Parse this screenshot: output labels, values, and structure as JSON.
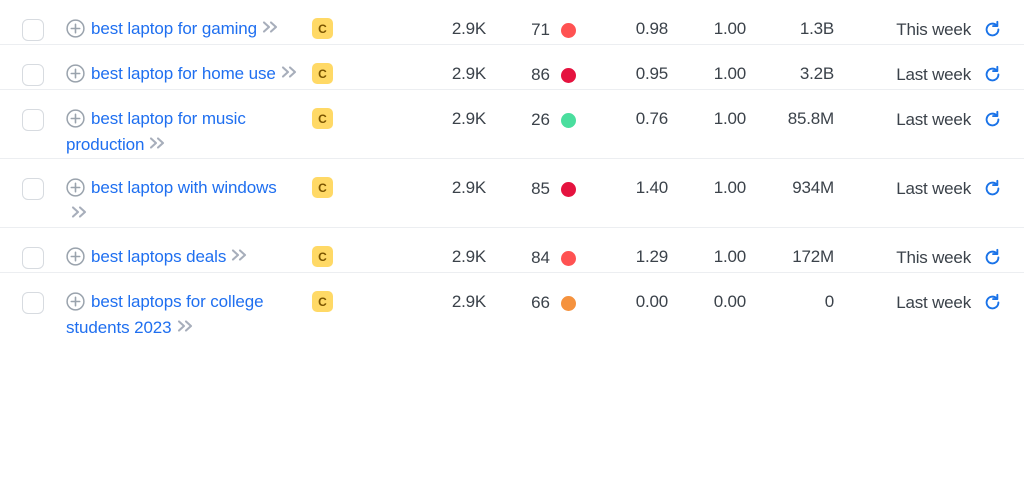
{
  "table": {
    "name": "keyword-overview-table",
    "intent_badge_letter": "C",
    "colors": {
      "link": "#1f6ff0",
      "badge_bg": "#ffd966",
      "badge_fg": "#7a5400",
      "refresh": "#1a73e8",
      "row_border": "#eceef1",
      "kd_very_hard": "#e5133f",
      "kd_hard": "#ff5252",
      "kd_easy": "#4ade9e",
      "kd_medium": "#f5923e"
    },
    "icons": {
      "add_keyword": "plus-circle-icon",
      "expand": "double-chevron-right-icon",
      "update": "refresh-icon",
      "select": "checkbox-icon"
    },
    "rows": [
      {
        "keyword": "best laptop for gaming",
        "intent": "C",
        "volume": "2.9K",
        "kd": "71",
        "kd_color": "#ff5252",
        "cpc": "0.98",
        "com": "1.00",
        "results": "1.3B",
        "updated": "This week"
      },
      {
        "keyword": "best laptop for home use",
        "intent": "C",
        "volume": "2.9K",
        "kd": "86",
        "kd_color": "#e5133f",
        "cpc": "0.95",
        "com": "1.00",
        "results": "3.2B",
        "updated": "Last week"
      },
      {
        "keyword": "best laptop for music production",
        "intent": "C",
        "volume": "2.9K",
        "kd": "26",
        "kd_color": "#4ade9e",
        "cpc": "0.76",
        "com": "1.00",
        "results": "85.8M",
        "updated": "Last week"
      },
      {
        "keyword": "best laptop with windows",
        "intent": "C",
        "volume": "2.9K",
        "kd": "85",
        "kd_color": "#e5133f",
        "cpc": "1.40",
        "com": "1.00",
        "results": "934M",
        "updated": "Last week"
      },
      {
        "keyword": "best laptops deals",
        "intent": "C",
        "volume": "2.9K",
        "kd": "84",
        "kd_color": "#ff5252",
        "cpc": "1.29",
        "com": "1.00",
        "results": "172M",
        "updated": "This week"
      },
      {
        "keyword": "best laptops for college students 2023",
        "intent": "C",
        "volume": "2.9K",
        "kd": "66",
        "kd_color": "#f5923e",
        "cpc": "0.00",
        "com": "0.00",
        "results": "0",
        "updated": "Last week"
      }
    ]
  }
}
